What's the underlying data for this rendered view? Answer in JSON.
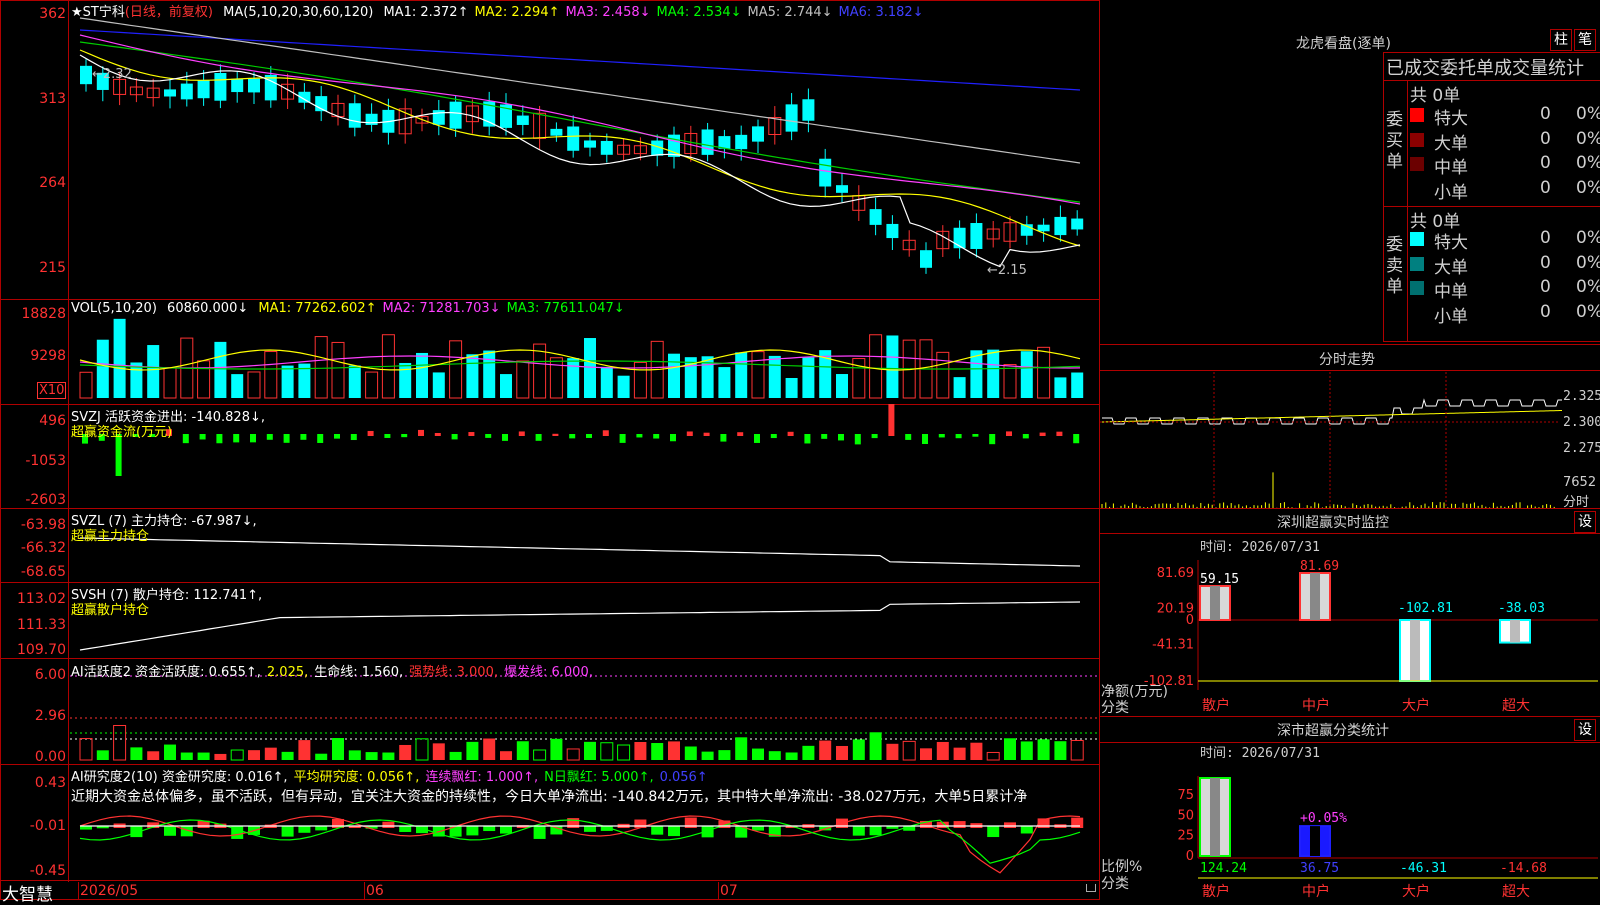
{
  "stock": {
    "star": "★",
    "name": "ST宁科",
    "period": "(日线，前复权)"
  },
  "price_panel": {
    "axis": [
      "362",
      "313",
      "264",
      "215"
    ],
    "ma_label": "MA(5,10,20,30,60,120)",
    "mas": [
      {
        "t": "MA1: 2.372↑",
        "c": "#ffffff"
      },
      {
        "t": "MA2: 2.294↑",
        "c": "#ffff00"
      },
      {
        "t": "MA3: 2.458↓",
        "c": "#ff40ff"
      },
      {
        "t": "MA4: 2.534↓",
        "c": "#00ff00"
      },
      {
        "t": "MA5: 2.744↓",
        "c": "#c0c0c0"
      },
      {
        "t": "MA6: 3.182↓",
        "c": "#4040ff"
      }
    ],
    "high_label": "←2.32",
    "low_label": "←2.15"
  },
  "vol_panel": {
    "axis": [
      "18828",
      "9298"
    ],
    "x10": "X10",
    "label": "VOL(5,10,20)",
    "value": "60860.000↓",
    "mas": [
      {
        "t": "MA1: 77262.602↑",
        "c": "#ffff00"
      },
      {
        "t": "MA2: 71281.703↓",
        "c": "#ff40ff"
      },
      {
        "t": "MA3: 77611.047↓",
        "c": "#00ff00"
      }
    ]
  },
  "svzj_panel": {
    "axis": [
      "496",
      "-1053",
      "-2603"
    ],
    "label": "SVZJ  活跃资金进出: -140.828↓,",
    "sub": "超赢资金流(万元)"
  },
  "svzl_panel": {
    "axis": [
      "-63.98",
      "-66.32",
      "-68.65"
    ],
    "label": "SVZL (7) 主力持仓: -67.987↓,",
    "sub": "超赢主力持仓"
  },
  "svsh_panel": {
    "axis": [
      "113.02",
      "111.33",
      "109.70"
    ],
    "label": "SVSH (7) 散户持仓: 112.741↑,",
    "sub": "超赢散户持仓"
  },
  "ai1_panel": {
    "axis": [
      "6.00",
      "2.96",
      "0.00"
    ],
    "parts": [
      {
        "t": "AI活跃度2 资金活跃度: 0.655↑,",
        "c": "#ffffff"
      },
      {
        "t": "2.025,",
        "c": "#ffff00"
      },
      {
        "t": "生命线: 1.560,",
        "c": "#ffffff"
      },
      {
        "t": "强势线: 3.000,",
        "c": "#ff3232"
      },
      {
        "t": "爆发线: 6.000,",
        "c": "#ff40ff"
      }
    ]
  },
  "ai2_panel": {
    "axis": [
      "0.43",
      "-0.01",
      "-0.45"
    ],
    "parts": [
      {
        "t": "AI研究度2(10) 资金研究度: 0.016↑,",
        "c": "#ffffff"
      },
      {
        "t": "平均研究度: 0.056↑,",
        "c": "#ffff00"
      },
      {
        "t": "连续飘红: 1.000↑,",
        "c": "#ff40ff"
      },
      {
        "t": "N日飘红: 5.000↑,",
        "c": "#00ff00"
      },
      {
        "t": "0.056↑",
        "c": "#4040ff"
      }
    ],
    "commentary": "近期大资金总体偏多，虽不活跃，但有异动，宜关注大资金的持续性，今日大单净流出: -140.842万元，其中特大单净流出: -38.027万元，大单5日累计净"
  },
  "bottom": {
    "logo": "大智慧",
    "dates": [
      "2026/05",
      "06",
      "07"
    ]
  },
  "right": {
    "lhb_title": "龙虎看盘(逐单)",
    "btn_zhu": "柱",
    "btn_bi": "笔",
    "stat_title": "已成交委托单成交量统计",
    "buy": {
      "side": "委买单",
      "count": "共 0单",
      "rows": [
        {
          "label": "特大",
          "v": "0",
          "p": "0%",
          "color": "#ff0000"
        },
        {
          "label": "大单",
          "v": "0",
          "p": "0%",
          "color": "#8b0000"
        },
        {
          "label": "中单",
          "v": "0",
          "p": "0%",
          "color": "#6b0000"
        },
        {
          "label": "小单",
          "v": "0",
          "p": "0%",
          "color": ""
        }
      ]
    },
    "sell": {
      "side": "委卖单",
      "count": "共 0单",
      "rows": [
        {
          "label": "特大",
          "v": "0",
          "p": "0%",
          "color": "#00ffff"
        },
        {
          "label": "大单",
          "v": "0",
          "p": "0%",
          "color": "#008080"
        },
        {
          "label": "中单",
          "v": "0",
          "p": "0%",
          "color": "#007070"
        },
        {
          "label": "小单",
          "v": "0",
          "p": "0%",
          "color": ""
        }
      ]
    },
    "fs_title": "分时走势",
    "fs_axis": [
      "2.325",
      "2.300",
      "2.275"
    ],
    "fs_vol": "7652",
    "fs_tag": "分时",
    "sz_title": "深圳超赢实时监控",
    "sz_set": "设",
    "sz_time": "时间: 2026/07/31",
    "sz_axis": [
      "81.69",
      "20.19",
      "0",
      "-41.31",
      "-102.81"
    ],
    "sz_unit": "净额(万元)",
    "sz_cat": "分类",
    "sz_bar_labels": [
      "59.15",
      "81.69",
      "-102.81",
      "-38.03"
    ],
    "cats": [
      "散户",
      "中户",
      "大户",
      "超大"
    ],
    "ss_title": "深市超赢分类统计",
    "ss_set": "设",
    "ss_time": "时间: 2026/07/31",
    "ss_axis": [
      "75",
      "50",
      "25",
      "0"
    ],
    "ss_unit": "比例%",
    "ss_cat": "分类",
    "ss_top_label": "+0.05%",
    "ss_vals": [
      "124.24",
      "36.75",
      "-46.31",
      "-14.68"
    ]
  },
  "chart_data": [
    {
      "type": "bar",
      "title": "深圳超赢实时监控",
      "categories": [
        "散户",
        "中户",
        "大户",
        "超大"
      ],
      "values": [
        59.15,
        81.69,
        -102.81,
        -38.03
      ],
      "ylim": [
        -102.81,
        81.69
      ],
      "ylabel": "净额(万元)"
    },
    {
      "type": "bar",
      "title": "深市超赢分类统计",
      "categories": [
        "散户",
        "中户",
        "大户",
        "超大"
      ],
      "values": [
        124.24,
        36.75,
        -46.31,
        -14.68
      ],
      "ylim": [
        0,
        75
      ],
      "ylabel": "比例%"
    }
  ]
}
